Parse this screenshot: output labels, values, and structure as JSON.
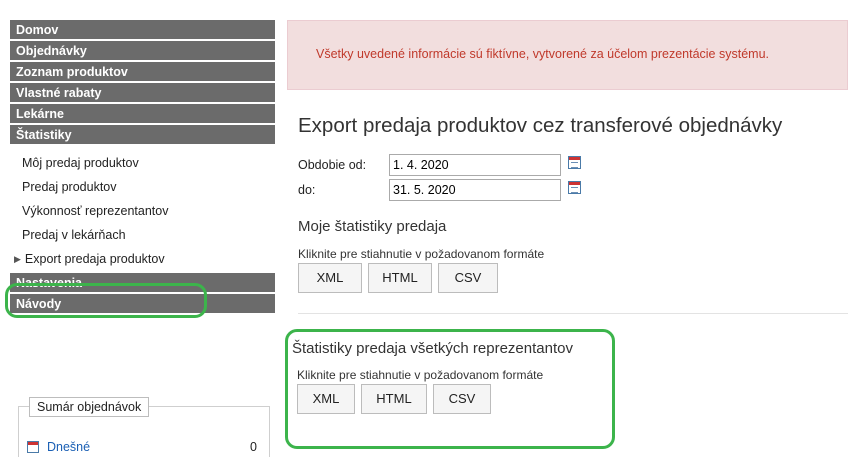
{
  "sidebar": {
    "nav": [
      {
        "label": "Domov"
      },
      {
        "label": "Objednávky"
      },
      {
        "label": "Zoznam produktov"
      },
      {
        "label": "Vlastné rabaty"
      },
      {
        "label": "Lekárne"
      },
      {
        "label": "Štatistiky"
      }
    ],
    "stats_items": [
      {
        "label": "Môj predaj produktov"
      },
      {
        "label": "Predaj produktov"
      },
      {
        "label": "Výkonnosť reprezentantov"
      },
      {
        "label": "Predaj v lekárňach"
      },
      {
        "label": "Export predaja produktov"
      }
    ],
    "nav_bottom": [
      {
        "label": "Nastavenia"
      },
      {
        "label": "Návody"
      }
    ],
    "summary": {
      "legend": "Sumár objednávok",
      "row_label": "Dnešné",
      "row_count": "0"
    }
  },
  "main": {
    "alert": "Všetky uvedené informácie sú fiktívne, vytvorené za účelom prezentácie systému.",
    "title": "Export predaja produktov cez transferové objednávky",
    "period_from_label": "Obdobie od:",
    "period_from_value": "1. 4. 2020",
    "period_to_label": "do:",
    "period_to_value": "31. 5. 2020",
    "my_stats": {
      "title": "Moje štatistiky predaja",
      "hint": "Kliknite pre stiahnutie v požadovanom formáte",
      "buttons": [
        "XML",
        "HTML",
        "CSV"
      ]
    },
    "all_stats": {
      "title": "Štatistiky predaja všetkých reprezentantov",
      "hint": "Kliknite pre stiahnutie v požadovanom formáte",
      "buttons": [
        "XML",
        "HTML",
        "CSV"
      ]
    }
  },
  "colors": {
    "nav_header_bg": "#6b6b6b",
    "alert_bg": "#f2dede",
    "alert_text": "#c0392b",
    "highlight": "#3cb44b",
    "link": "#1a5fb4"
  }
}
